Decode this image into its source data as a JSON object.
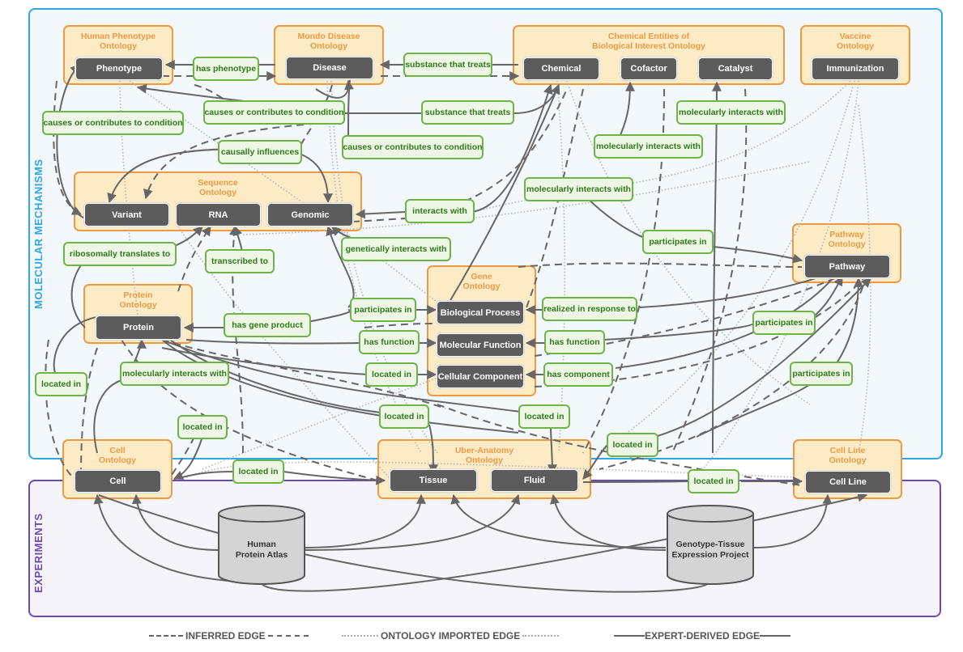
{
  "regions": {
    "molecular_mechanisms": "MOLECULAR MECHANISMS",
    "experiments": "EXPERIMENTS"
  },
  "colors": {
    "molecular_border": "#2ea6e8",
    "experiments_border": "#6a4bb5",
    "ontology_border": "#ec9a44",
    "ontology_fill": "#fdebc6",
    "entity_fill": "#5c5c5c",
    "edge_label_border": "#6fb449",
    "edge_label_text": "#2f7a1a",
    "edge_color": "#666666"
  },
  "ontologies": [
    {
      "id": "hpo",
      "title": "Human Phenotype\nOntology"
    },
    {
      "id": "mondo",
      "title": "Mondo Disease\nOntology"
    },
    {
      "id": "chebi",
      "title": "Chemical Entities of\nBiological Interest Ontology"
    },
    {
      "id": "vo",
      "title": "Vaccine\nOntology"
    },
    {
      "id": "so",
      "title": "Sequence\nOntology"
    },
    {
      "id": "pw",
      "title": "Pathway\nOntology"
    },
    {
      "id": "pr",
      "title": "Protein\nOntology"
    },
    {
      "id": "go",
      "title": "Gene\nOntology"
    },
    {
      "id": "cl",
      "title": "Cell\nOntology"
    },
    {
      "id": "uberon",
      "title": "Uber-Anatomy\nOntology"
    },
    {
      "id": "clo",
      "title": "Cell Line\nOntology"
    }
  ],
  "entities": [
    {
      "id": "phenotype",
      "label": "Phenotype"
    },
    {
      "id": "disease",
      "label": "Disease"
    },
    {
      "id": "chemical",
      "label": "Chemical"
    },
    {
      "id": "cofactor",
      "label": "Cofactor"
    },
    {
      "id": "catalyst",
      "label": "Catalyst"
    },
    {
      "id": "immunization",
      "label": "Immunization"
    },
    {
      "id": "variant",
      "label": "Variant"
    },
    {
      "id": "rna",
      "label": "RNA"
    },
    {
      "id": "genomic",
      "label": "Genomic"
    },
    {
      "id": "pathway",
      "label": "Pathway"
    },
    {
      "id": "protein",
      "label": "Protein"
    },
    {
      "id": "bp",
      "label": "Biological Process"
    },
    {
      "id": "mf",
      "label": "Molecular Function"
    },
    {
      "id": "cc",
      "label": "Cellular Component"
    },
    {
      "id": "cell",
      "label": "Cell"
    },
    {
      "id": "tissue",
      "label": "Tissue"
    },
    {
      "id": "fluid",
      "label": "Fluid"
    },
    {
      "id": "cellline",
      "label": "Cell Line"
    }
  ],
  "databases": [
    {
      "id": "hpa",
      "label": "Human\nProtein Atlas"
    },
    {
      "id": "gtex",
      "label": "Genotype-Tissue\nExpression Project"
    }
  ],
  "edge_labels": [
    "has phenotype",
    "substance that treats",
    "causes or contributes to condition",
    "causes or contributes to condition",
    "substance that treats",
    "molecularly interacts with",
    "causally influences",
    "causes or contributes to condition",
    "molecularly interacts with",
    "molecularly interacts with",
    "interacts with",
    "participates in",
    "ribosomally translates to",
    "transcribed to",
    "genetically interacts with",
    "participates in",
    "realized in response to",
    "has gene product",
    "participates in",
    "has function",
    "has function",
    "located in",
    "molecularly interacts with",
    "located in",
    "has component",
    "participates in",
    "located in",
    "located in",
    "located in",
    "located in",
    "located in",
    "located in"
  ],
  "legend": {
    "inferred": "INFERRED EDGE",
    "ontology_imported": "ONTOLOGY IMPORTED EDGE",
    "expert_derived": "EXPERT-DERIVED EDGE"
  }
}
